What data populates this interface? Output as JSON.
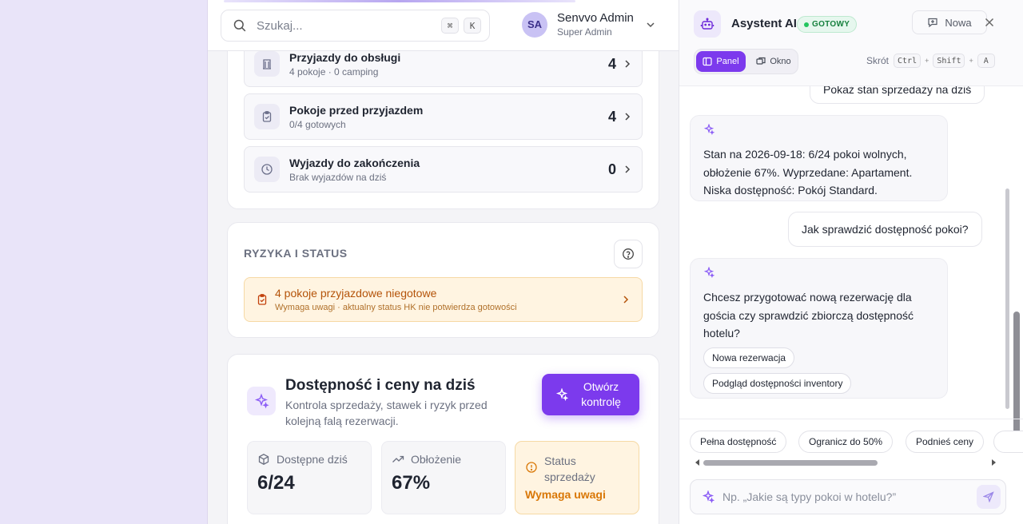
{
  "topbar": {
    "search_placeholder": "Szukaj...",
    "shortcut_keys": [
      "⌘",
      "K"
    ],
    "user": {
      "initials": "SA",
      "name": "Senvvo Admin",
      "role": "Super Admin"
    }
  },
  "operations": {
    "rows": [
      {
        "title": "Przyjazdy do obsługi",
        "subtitle": "4 pokoje · 0 camping",
        "count": "4",
        "icon": "building-icon"
      },
      {
        "title": "Pokoje przed przyjazdem",
        "subtitle": "0/4 gotowych",
        "count": "4",
        "icon": "clipboard-check-icon"
      },
      {
        "title": "Wyjazdy do zakończenia",
        "subtitle": "Brak wyjazdów na dziś",
        "count": "0",
        "icon": "clock-icon"
      }
    ]
  },
  "risks": {
    "title": "RYZYKA I STATUS",
    "alert": {
      "title": "4 pokoje przyjazdowe niegotowe",
      "subtitle": "Wymaga uwagi · aktualny status HK nie potwierdza gotowości"
    }
  },
  "availability": {
    "title": "Dostępność i ceny na dziś",
    "subtitle": "Kontrola sprzedaży, stawek i ryzyk przed kolejną falą rezerwacji.",
    "button_label": "Otwórz kontrolę",
    "stats": [
      {
        "label": "Dostępne dziś",
        "value": "6/24",
        "icon": "box-icon"
      },
      {
        "label": "Obłożenie",
        "value": "67%",
        "icon": "trend-up-icon"
      },
      {
        "label": "Status sprzedaży",
        "value": "Wymaga uwagi",
        "icon": "alert-circle-icon"
      }
    ]
  },
  "assistant": {
    "title": "Asystent AI",
    "status": "GOTOWY",
    "new_label": "Nowa",
    "modes": {
      "panel": "Panel",
      "window": "Okno"
    },
    "shortcut": {
      "label": "Skrót",
      "keys": [
        "Ctrl",
        "Shift",
        "A"
      ]
    },
    "messages": [
      {
        "role": "user",
        "text": "Pokaż stan sprzedaży na dziś"
      },
      {
        "role": "assistant",
        "text": "Stan na 2026-09-18: 6/24 pokoi wolnych, obłożenie 67%. Wyprzedane: Apartament. Niska dostępność: Pokój Standard."
      },
      {
        "role": "user",
        "text": "Jak sprawdzić dostępność pokoi?"
      },
      {
        "role": "assistant",
        "text": "Chcesz przygotować nową rezerwację dla gościa czy sprawdzić zbiorczą dostępność hotelu?",
        "chips": [
          "Nowa rezerwacja",
          "Podgląd dostępności inventory"
        ]
      }
    ],
    "quick_actions": [
      "Pełna dostępność",
      "Ogranicz do 50%",
      "Podnieś ceny"
    ],
    "input_placeholder": "Np. „Jakie są typy pokoi w hotelu?”"
  },
  "colors": {
    "accent": "#7c3aed",
    "warning": "#d97706",
    "success": "#22c55e"
  }
}
